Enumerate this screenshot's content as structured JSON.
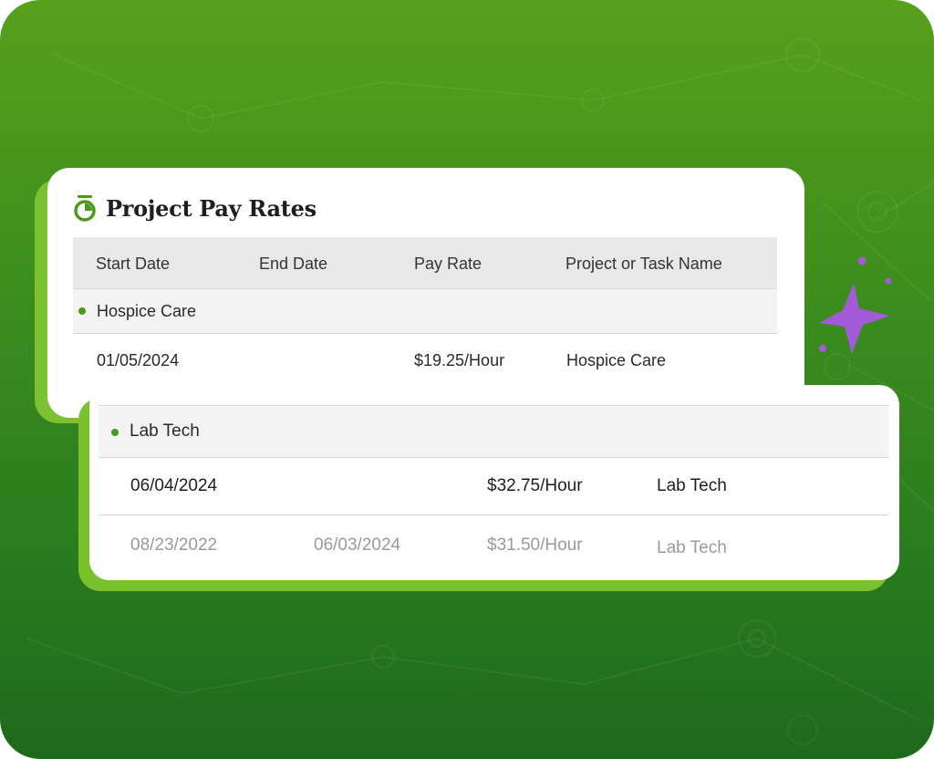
{
  "card": {
    "title": "Project Pay Rates",
    "columns": {
      "start_date": "Start Date",
      "end_date": "End Date",
      "pay_rate": "Pay Rate",
      "project_name": "Project or Task Name"
    },
    "groups": [
      {
        "label": "Hospice Care",
        "rows": [
          {
            "start_date": "01/05/2024",
            "end_date": "",
            "pay_rate": "$19.25/Hour",
            "project_name": "Hospice Care"
          }
        ]
      },
      {
        "label": "Lab Tech",
        "rows": [
          {
            "start_date": "06/04/2024",
            "end_date": "",
            "pay_rate": "$32.75/Hour",
            "project_name": "Lab Tech"
          },
          {
            "start_date": "08/23/2022",
            "end_date": "06/03/2024",
            "pay_rate": "$31.50/Hour",
            "project_name": "Lab Tech"
          }
        ]
      }
    ]
  },
  "colors": {
    "background_top": "#56a01c",
    "background_bottom": "#1d6a1d",
    "accent_green": "#4a9a1c",
    "card_shadow": "#7cc230",
    "sparkle": "#a35ad6",
    "current_row_text": "#1e1e1e",
    "past_row_text": "#9a9a9a"
  },
  "icons": {
    "title_icon": "stopwatch-icon",
    "decoration": "sparkle-icon"
  }
}
